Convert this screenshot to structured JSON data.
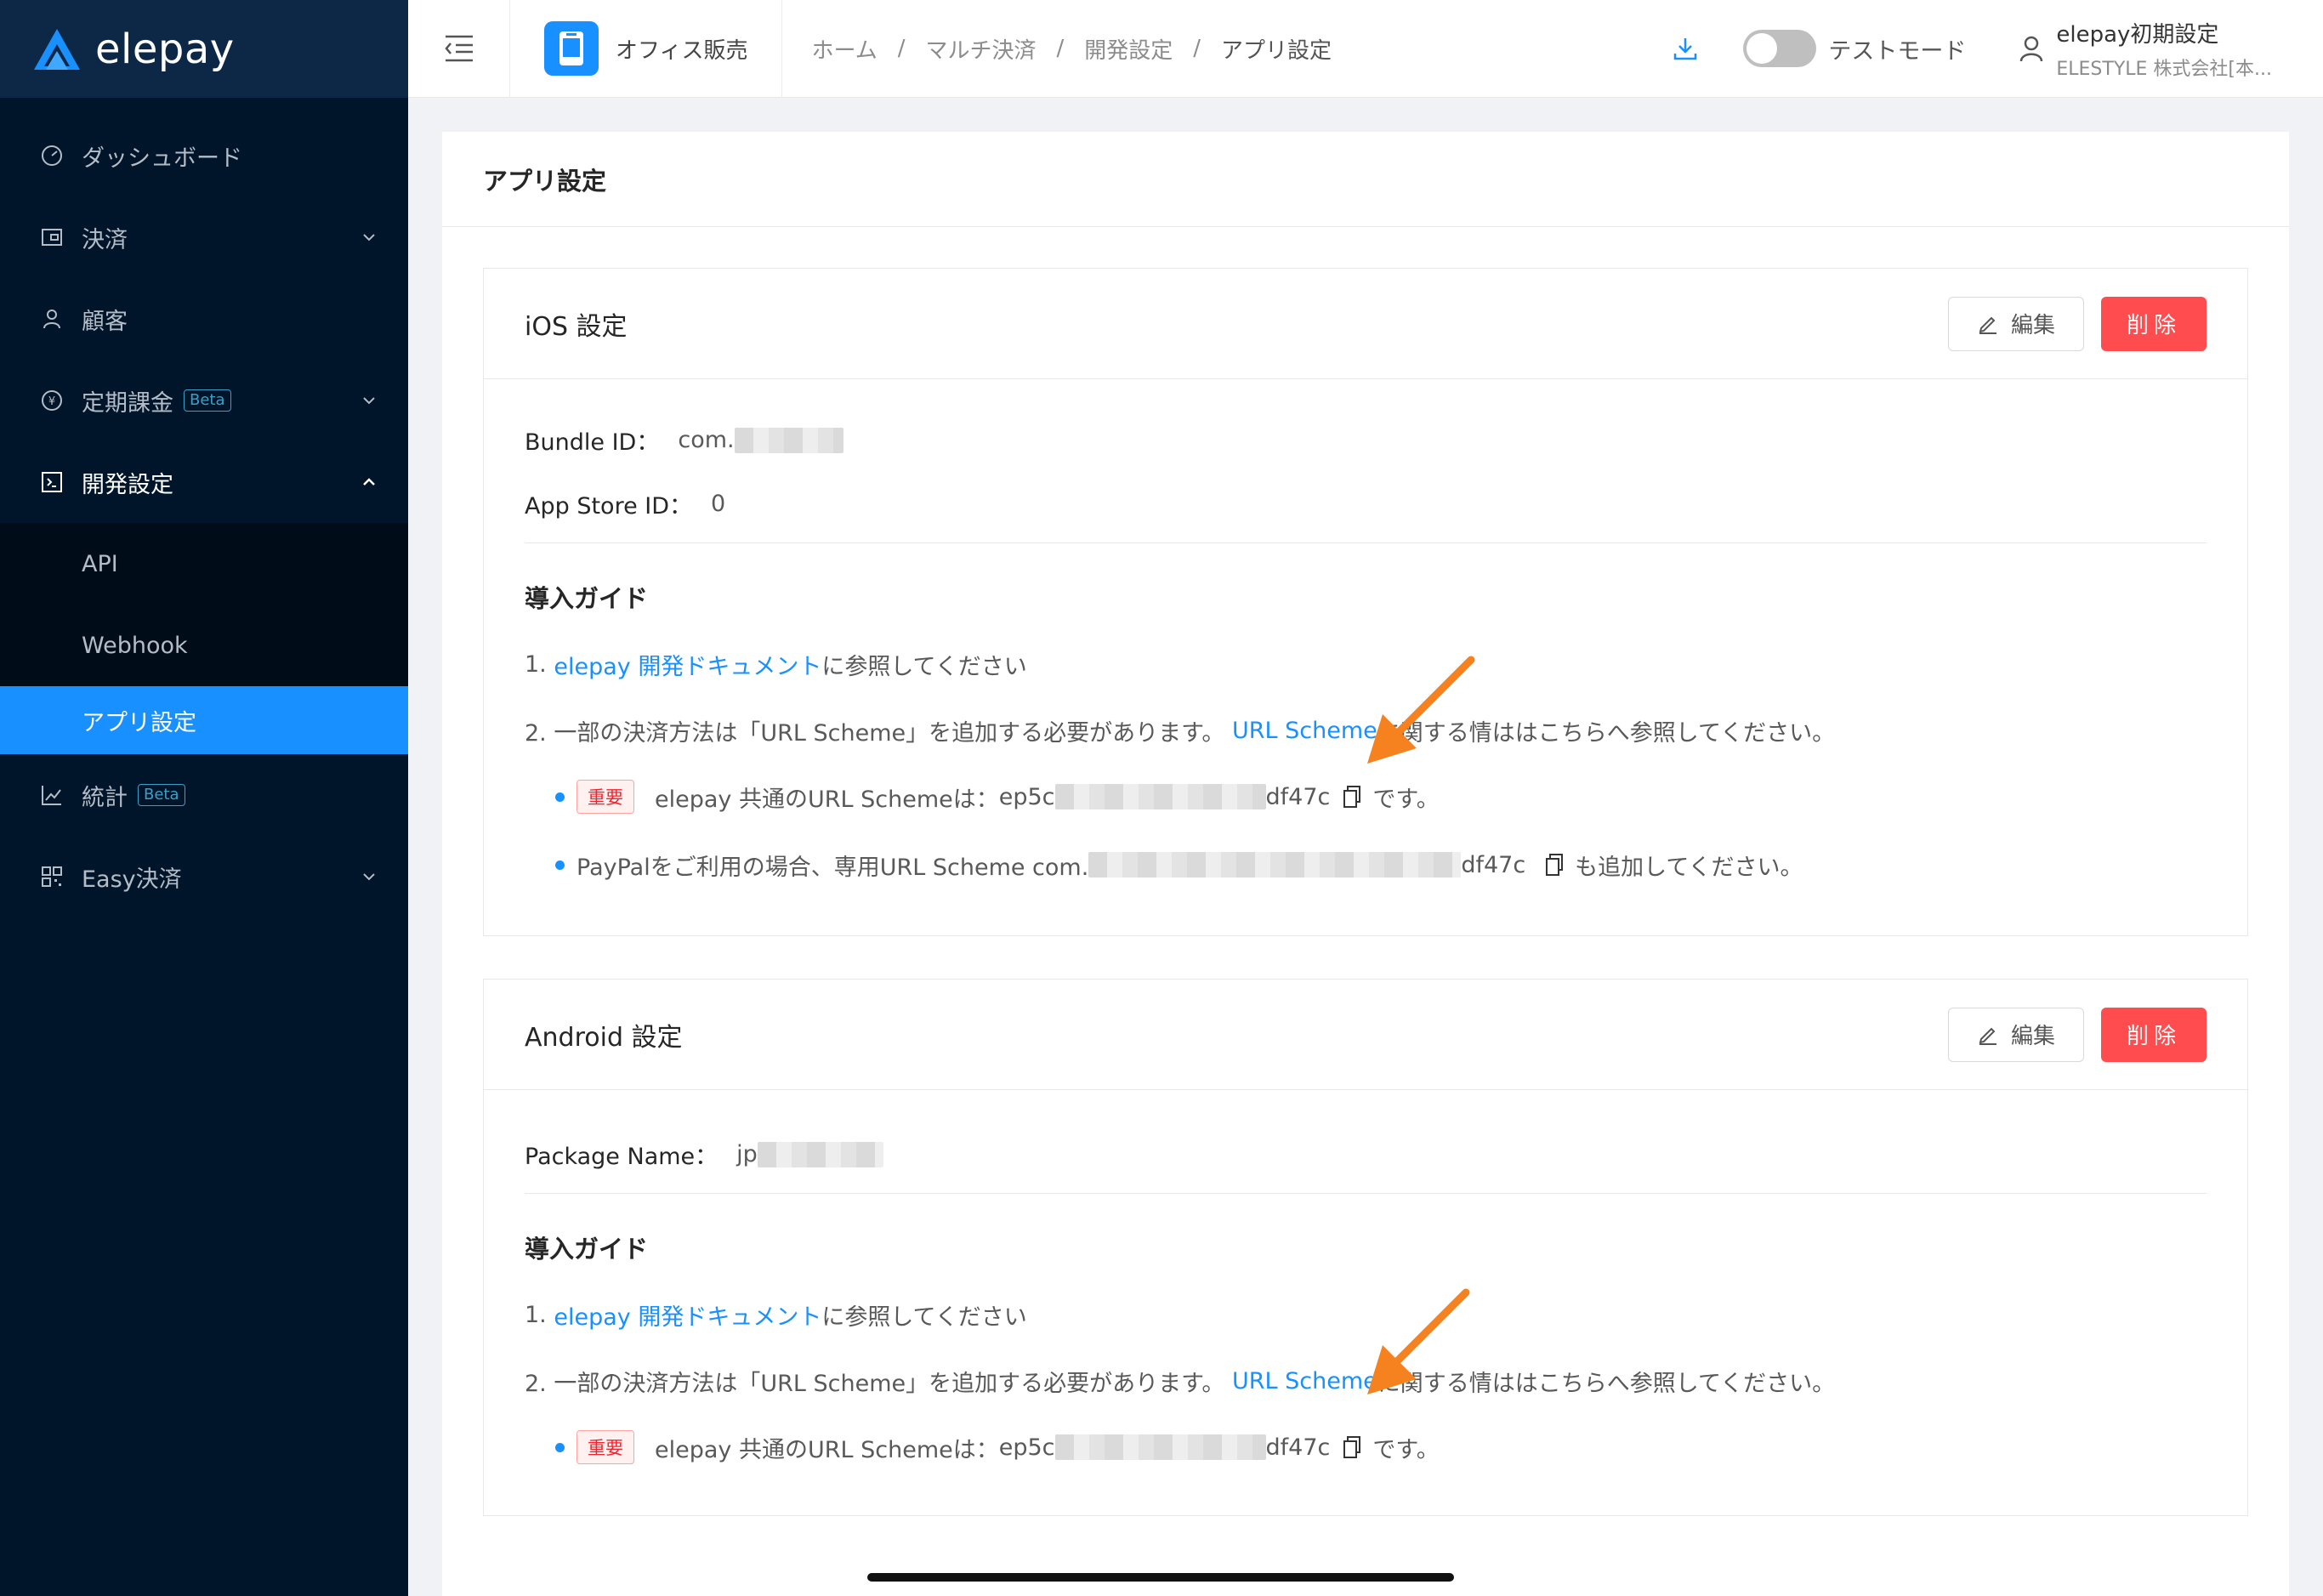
{
  "brand": {
    "name": "elepay"
  },
  "sidebar": {
    "items": [
      {
        "label": "ダッシュボード",
        "icon": "dashboard-icon"
      },
      {
        "label": "決済",
        "icon": "wallet-icon"
      },
      {
        "label": "顧客",
        "icon": "user-icon"
      },
      {
        "label": "定期課金",
        "icon": "recurring-icon",
        "badge": "Beta"
      },
      {
        "label": "開発設定",
        "icon": "code-icon"
      },
      {
        "label": "統計",
        "icon": "chart-icon",
        "badge": "Beta"
      },
      {
        "label": "Easy決済",
        "icon": "qr-icon"
      }
    ],
    "submenu": [
      {
        "label": "API"
      },
      {
        "label": "Webhook"
      },
      {
        "label": "アプリ設定"
      }
    ]
  },
  "header": {
    "shop_name": "オフィス販売",
    "breadcrumb": [
      "ホーム",
      "マルチ決済",
      "開発設定",
      "アプリ設定"
    ],
    "breadcrumb_sep": "/",
    "toggle_label": "テストモード",
    "test_mode_on": false,
    "user_name": "elepay初期設定",
    "user_org": "ELESTYLE 株式会社[本..."
  },
  "page": {
    "title": "アプリ設定"
  },
  "buttons": {
    "edit": "編集",
    "delete": "削除"
  },
  "ios": {
    "title": "iOS 設定",
    "bundle_label": "Bundle ID：",
    "bundle_value": "com.",
    "appstore_label": "App Store ID：",
    "appstore_value": "0",
    "guide_title": "導入ガイド",
    "step1_num": "1.",
    "step1_link": "elepay 開発ドキュメント",
    "step1_text": " に参照してください",
    "step2_text": "2. 一部の決済方法は「URL Scheme」を追加する必要があります。",
    "step2_link": "URL Scheme",
    "step2_rest": " に関する情ははこちらへ参照してください。",
    "tag": "重要",
    "scheme_label": "elepay 共通のURL Schemeは： ",
    "scheme_prefix": "ep5c",
    "scheme_suffix": "df47c",
    "scheme_end": "です。",
    "paypal_text": "PayPalをご利用の場合、専用URL Scheme com.",
    "paypal_suffix": "df47c",
    "paypal_end": "も追加してください。"
  },
  "android": {
    "title": "Android 設定",
    "package_label": "Package Name：",
    "package_value": "jp",
    "guide_title": "導入ガイド",
    "step1_num": "1.",
    "step1_link": "elepay 開発ドキュメント",
    "step1_text": " に参照してください",
    "step2_text": "2. 一部の決済方法は「URL Scheme」を追加する必要があります。",
    "step2_link": "URL Scheme",
    "step2_rest": " に関する情ははこちらへ参照してください。",
    "tag": "重要",
    "scheme_label": "elepay 共通のURL Schemeは： ",
    "scheme_prefix": "ep5c",
    "scheme_suffix": "df47c",
    "scheme_end": "です。"
  },
  "colors": {
    "sidebar": "#001529",
    "accent": "#1890ff",
    "danger": "#ff4d4f",
    "annotation_arrow": "#f5821f"
  }
}
